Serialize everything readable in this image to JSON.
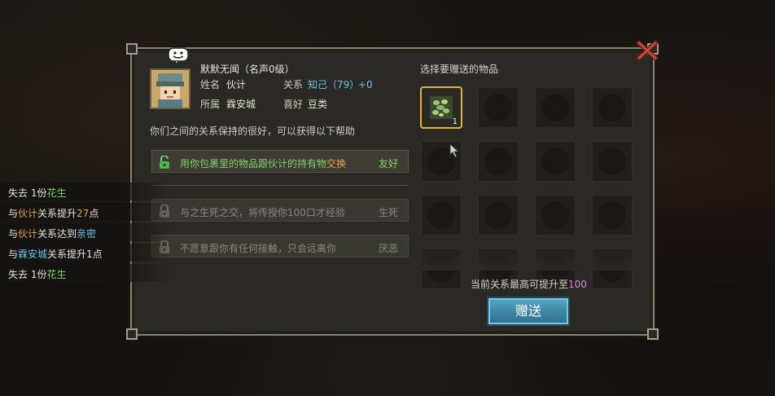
{
  "character": {
    "title": "默默无闻（名声0级）",
    "name_label": "姓名",
    "name": "伙计",
    "relation_label": "关系",
    "relation_status": "知己",
    "relation_points": "（79）",
    "relation_bonus": "+0",
    "faction_label": "所属",
    "faction": "霖安城",
    "hobby_label": "喜好",
    "hobby": "豆类"
  },
  "relation_desc": "你们之间的关系保持的很好，可以获得以下帮助",
  "benefits": [
    {
      "text_a": "用你包裹里的物品跟伙计的持有物",
      "text_b": "交换",
      "tag": "友好",
      "unlocked": true
    },
    {
      "text_a": "与之生死之交，将传授你100口才经验",
      "tag": "生死",
      "unlocked": false
    },
    {
      "text_a": "不愿意跟你有任何接触，只会远离你",
      "tag": "厌恶",
      "unlocked": false
    }
  ],
  "gift": {
    "title": "选择要赠送的物品",
    "selected_item_count": "1",
    "max_text_a": "当前关系最高可提升至",
    "max_value": "100",
    "button": "赠送"
  },
  "log": [
    {
      "a": "失去 1份",
      "b": "花生",
      "c": ""
    },
    {
      "a": "与",
      "b": "伙计",
      "c": "关系提升",
      "d": "27",
      "e": "点"
    },
    {
      "a": "与",
      "b": "伙计",
      "c": "关系达到",
      "d": "亲密",
      "e": ""
    },
    {
      "a": "与",
      "b": "霖安城",
      "c": "关系提升",
      "d": "1",
      "e": "点"
    },
    {
      "a": "失去 1份",
      "b": "花生",
      "c": ""
    }
  ],
  "colors": {
    "accent_blue": "#6cc3e8",
    "accent_green": "#7fd46a",
    "accent_pink": "#d98ad9",
    "accent_orange": "#e2a24a",
    "frame": "#8c8270"
  }
}
